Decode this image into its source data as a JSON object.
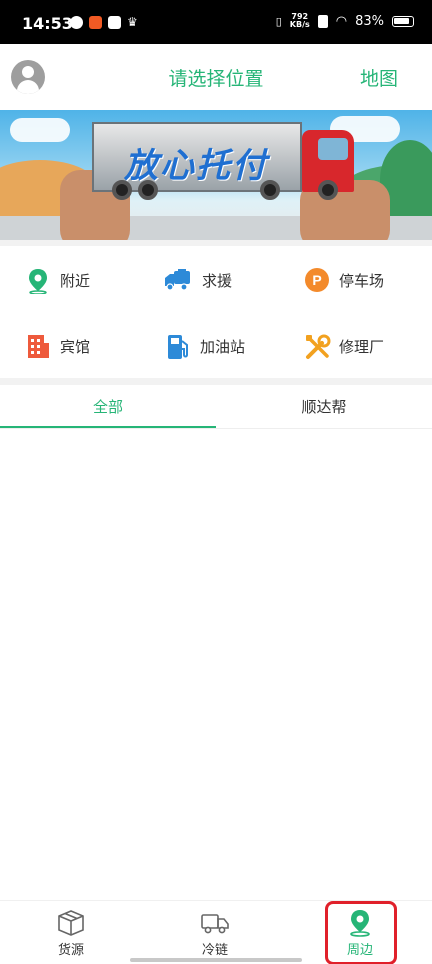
{
  "status_bar": {
    "time": "14:53",
    "net_speed_value": "792",
    "net_speed_unit": "KB/s",
    "battery": "83%"
  },
  "header": {
    "title": "请选择位置",
    "map_label": "地图"
  },
  "banner": {
    "headline": "放心托付"
  },
  "menu": {
    "items": [
      {
        "label": "附近",
        "icon": "location-pin-icon"
      },
      {
        "label": "求援",
        "icon": "rescue-truck-icon"
      },
      {
        "label": "停车场",
        "icon": "parking-icon"
      },
      {
        "label": "宾馆",
        "icon": "hotel-icon"
      },
      {
        "label": "加油站",
        "icon": "gas-station-icon"
      },
      {
        "label": "修理厂",
        "icon": "repair-tools-icon"
      }
    ]
  },
  "tabs": [
    {
      "label": "全部",
      "active": true
    },
    {
      "label": "顺达帮",
      "active": false
    }
  ],
  "bottom_nav": [
    {
      "label": "货源",
      "icon": "box-icon",
      "active": false
    },
    {
      "label": "冷链",
      "icon": "truck-icon",
      "active": false
    },
    {
      "label": "周边",
      "icon": "location-pin-icon",
      "active": true
    }
  ],
  "colors": {
    "accent": "#26b577",
    "highlight": "#e0202a"
  }
}
